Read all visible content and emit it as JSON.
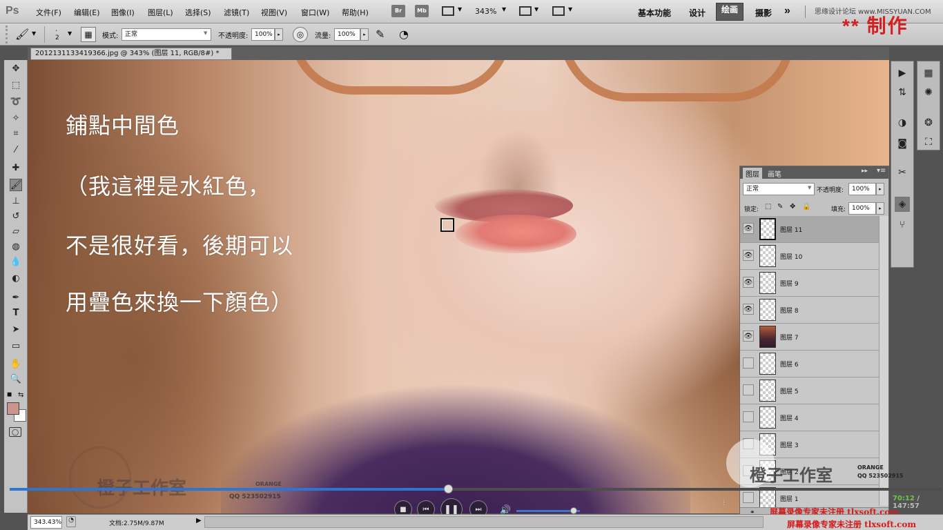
{
  "app": {
    "logo": "Ps"
  },
  "menu": [
    "文件(F)",
    "编辑(E)",
    "图像(I)",
    "图层(L)",
    "选择(S)",
    "滤镜(T)",
    "视图(V)",
    "窗口(W)",
    "帮助(H)"
  ],
  "appbar": {
    "br": "Br",
    "mb": "Mb",
    "zoom": "343%"
  },
  "workspaces": {
    "items": [
      "基本功能",
      "设计",
      "绘画",
      "摄影"
    ],
    "active": "绘画",
    "more": "»"
  },
  "top_watermark": "思缘设计论坛 www.MISSYUAN.COM",
  "options": {
    "brush_size": "2",
    "mode_label": "模式:",
    "mode_value": "正常",
    "opacity_label": "不透明度:",
    "opacity_value": "100%",
    "flow_label": "流量:",
    "flow_value": "100%"
  },
  "maker_overlay": "** 制作",
  "document": {
    "tab_title": "2012131133419366.jpg @ 343% (图层 11, RGB/8#) *",
    "close": "×"
  },
  "captions": [
    "鋪點中間色",
    "（我這裡是水紅色，",
    "不是很好看，後期可以",
    "用疊色來換一下顏色）"
  ],
  "canvas_watermark": {
    "studio": "橙子工作室",
    "qq": "QQ 523502915",
    "orange": "ORANGE"
  },
  "layers_panel": {
    "tabs": [
      "图层",
      "画笔"
    ],
    "active_tab": "图层",
    "blend_mode": "正常",
    "opacity_label": "不透明度:",
    "opacity_value": "100%",
    "lock_label": "锁定:",
    "fill_label": "填充:",
    "fill_value": "100%",
    "layers": [
      {
        "name": "图层 11",
        "visible": true,
        "selected": true,
        "thumb": "transparent"
      },
      {
        "name": "图层 10",
        "visible": true,
        "selected": false,
        "thumb": "transparent"
      },
      {
        "name": "图层 9",
        "visible": true,
        "selected": false,
        "thumb": "transparent"
      },
      {
        "name": "图层 8",
        "visible": true,
        "selected": false,
        "thumb": "transparent"
      },
      {
        "name": "图层 7",
        "visible": true,
        "selected": false,
        "thumb": "photo"
      },
      {
        "name": "图层 6",
        "visible": false,
        "selected": false,
        "thumb": "transparent"
      },
      {
        "name": "图层 5",
        "visible": false,
        "selected": false,
        "thumb": "transparent"
      },
      {
        "name": "图层 4",
        "visible": false,
        "selected": false,
        "thumb": "transparent"
      },
      {
        "name": "图层 3",
        "visible": false,
        "selected": false,
        "thumb": "transparent"
      },
      {
        "name": "图层 2",
        "visible": false,
        "selected": false,
        "thumb": "transparent"
      },
      {
        "name": "图层 1",
        "visible": false,
        "selected": false,
        "thumb": "transparent"
      }
    ],
    "watermark": "橙子工作室",
    "watermark_qq": "QQ 523502915",
    "watermark_orange": "ORANGE"
  },
  "status": {
    "zoom": "343.43%",
    "doc_info": "文档:2.75M/9.87M"
  },
  "player": {
    "progress": 0.47,
    "volume": 0.9,
    "time_current": "70:12",
    "time_total": "147:57"
  },
  "registration": [
    "屏幕录像专家未注册 tlxsoft.com",
    "屏幕录像专家未注册 tlxsoft.com"
  ],
  "colors": {
    "foreground": "#c8968a",
    "background": "#ffffff",
    "accent": "#2e74d4"
  }
}
